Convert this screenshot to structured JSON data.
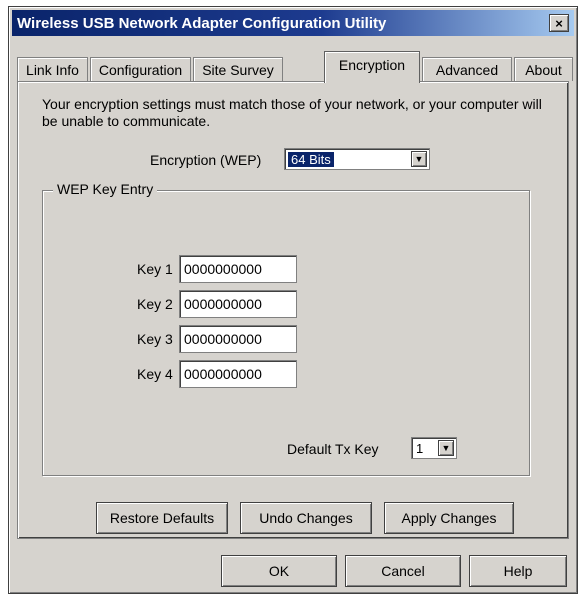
{
  "window": {
    "title": "Wireless USB Network Adapter Configuration Utility",
    "close_label": "×"
  },
  "tabs": [
    {
      "label": "Link Info"
    },
    {
      "label": "Configuration"
    },
    {
      "label": "Site Survey"
    },
    {
      "label": "Encryption",
      "active": true
    },
    {
      "label": "Advanced"
    },
    {
      "label": "About"
    }
  ],
  "encryption": {
    "notice": "Your encryption settings must match those of your network, or your computer will be unable to communicate.",
    "wep_label": "Encryption (WEP)",
    "wep_value": "64 Bits",
    "arrow": "▼"
  },
  "wep_key_entry": {
    "group_label": "WEP Key Entry",
    "keys": [
      {
        "label": "Key 1",
        "value": "0000000000"
      },
      {
        "label": "Key 2",
        "value": "0000000000"
      },
      {
        "label": "Key 3",
        "value": "0000000000"
      },
      {
        "label": "Key 4",
        "value": "0000000000"
      }
    ],
    "default_tx_label": "Default Tx Key",
    "default_tx_value": "1"
  },
  "actions": {
    "restore": "Restore Defaults",
    "undo": "Undo Changes",
    "apply": "Apply Changes"
  },
  "footer": {
    "ok": "OK",
    "cancel": "Cancel",
    "help": "Help"
  }
}
